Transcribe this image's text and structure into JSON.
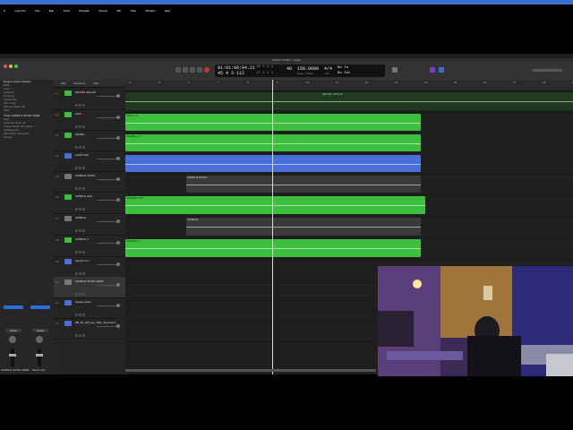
{
  "menubar": {
    "items": [
      "Logic Pro",
      "File",
      "Edit",
      "Track",
      "Navigate",
      "Record",
      "Mix",
      "View",
      "Window",
      "Help"
    ]
  },
  "window": {
    "title": "SUNNY INTRO - Tracks"
  },
  "transport": {
    "time": "01:01:08:04.21",
    "bars": "45  4  3  112",
    "time_small": "16  1  1  1",
    "time_small2": "17  1  1  1",
    "tempo": "158.0000",
    "tempo_label": "Keep Tempo",
    "signature": "4/4",
    "signature_sub": "/16",
    "key": "No In",
    "key2": "No Out",
    "bpm_small": "48"
  },
  "inspector": {
    "header": "Region: Audio Defaults",
    "rows": [
      "Mute:",
      "Loop:",
      "Quantize:",
      "Q-Swing:",
      "Transpose:",
      "Fine Tune:",
      "Flex & Follow: Off",
      "Gain:"
    ],
    "track_header": "Track: SAMPLE INTRO VERB",
    "track_rows": [
      "Icon:",
      "Channel: Audio 15",
      "Freeze Mode: Pre Fader",
      "Q-Reference:",
      "Flex Mode: Automatic",
      "Groove:"
    ],
    "strip_left": "SAMPLE INTRO VERB",
    "strip_right": "Stereo Out",
    "read": "Read",
    "bounce": "Bnce"
  },
  "tracklist": {
    "toolbar": [
      "Edit",
      "Functions",
      "View"
    ],
    "tracks": [
      {
        "num": "11",
        "name": "DRUMS GROUP",
        "color": "#3cbf3c"
      },
      {
        "num": "12",
        "name": "KICK",
        "color": "#3cbf3c"
      },
      {
        "num": "13",
        "name": "SNARE",
        "color": "#3cbf3c"
      },
      {
        "num": "14",
        "name": "LOOP HAT",
        "color": "#4a6fd9"
      },
      {
        "num": "15",
        "name": "SAMPLE PIANO",
        "color": "#777777"
      },
      {
        "num": "16",
        "name": "SAMPLE chck",
        "color": "#3cbf3c"
      },
      {
        "num": "17",
        "name": "SAMPLE",
        "color": "#777777"
      },
      {
        "num": "18",
        "name": "SAMPLE 2",
        "color": "#3cbf3c"
      },
      {
        "num": "19",
        "name": "sample trim",
        "color": "#4a6fd9"
      },
      {
        "num": "20",
        "name": "SAMPLE INTRO VERB",
        "color": "#777777"
      },
      {
        "num": "21",
        "name": "sample piano",
        "color": "#4a6fd9"
      },
      {
        "num": "22",
        "name": "RB_Fk_106_key_Bad_movement",
        "color": "#4a6fd9"
      }
    ]
  },
  "ruler": {
    "labels": [
      "4",
      "5",
      "6",
      "7",
      "8",
      "9",
      "10",
      "11",
      "12",
      "13",
      "14",
      "15",
      "16",
      "17",
      "18",
      "19",
      "20",
      "21",
      "22",
      "23"
    ]
  },
  "regions": {
    "drums_group": "DRUMS GROUP",
    "kick": "KICK_2.3",
    "snare": "SNARE_2.3",
    "piano": "SAMPLE PIANO",
    "chck": "SAMPLE chck",
    "sample": "SAMPLE",
    "sample2": "SAMPLE 2"
  },
  "colors": {
    "green": "#3cbf3c",
    "blue": "#4a6fd9",
    "grey": "#555555",
    "accent": "#2b6fd6"
  }
}
